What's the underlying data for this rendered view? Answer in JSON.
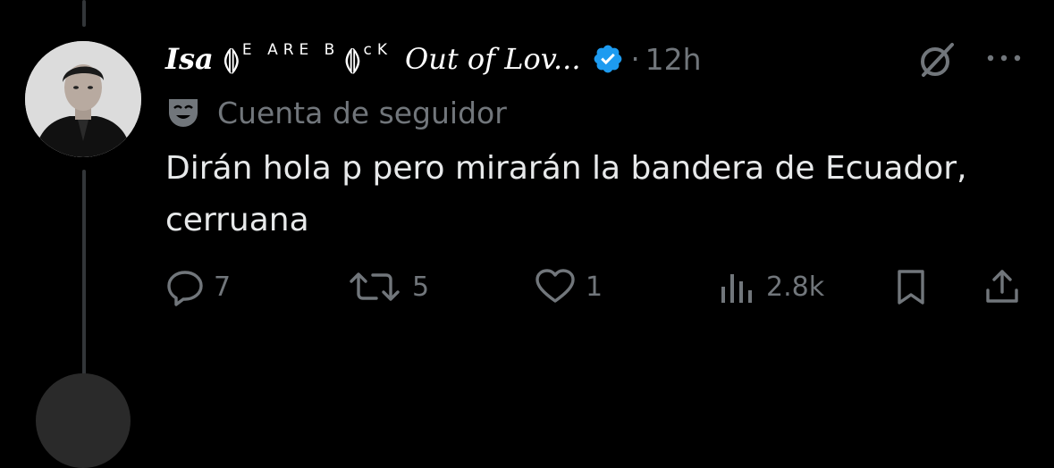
{
  "tweet": {
    "display_name_prefix": "Isa",
    "deco_left": "⟬⟭",
    "caps_1": "E ARE B",
    "deco_mid": "⟬⟭",
    "caps_2": "cK",
    "display_name_tail": "Out of Lov...",
    "separator": "·",
    "time": "12h",
    "follower_label": "Cuenta de seguidor",
    "text": "Dirán hola p pero mirarán la bandera de Ecuador, cerruana"
  },
  "actions": {
    "replies": "7",
    "reposts": "5",
    "likes": "1",
    "views": "2.8k"
  },
  "icons": {
    "avatar": "avatar",
    "verified": "verified-badge-icon",
    "grok": "grok-icon",
    "more": "more-options-icon",
    "follower": "theater-mask-icon",
    "reply": "reply-icon",
    "repost": "repost-icon",
    "like": "like-icon",
    "views": "views-icon",
    "bookmark": "bookmark-icon",
    "share": "share-icon"
  },
  "colors": {
    "background": "#000000",
    "text_primary": "#e7e9ea",
    "text_secondary": "#71767b",
    "verified_blue": "#1d9bf0",
    "thread_line": "#333639"
  }
}
